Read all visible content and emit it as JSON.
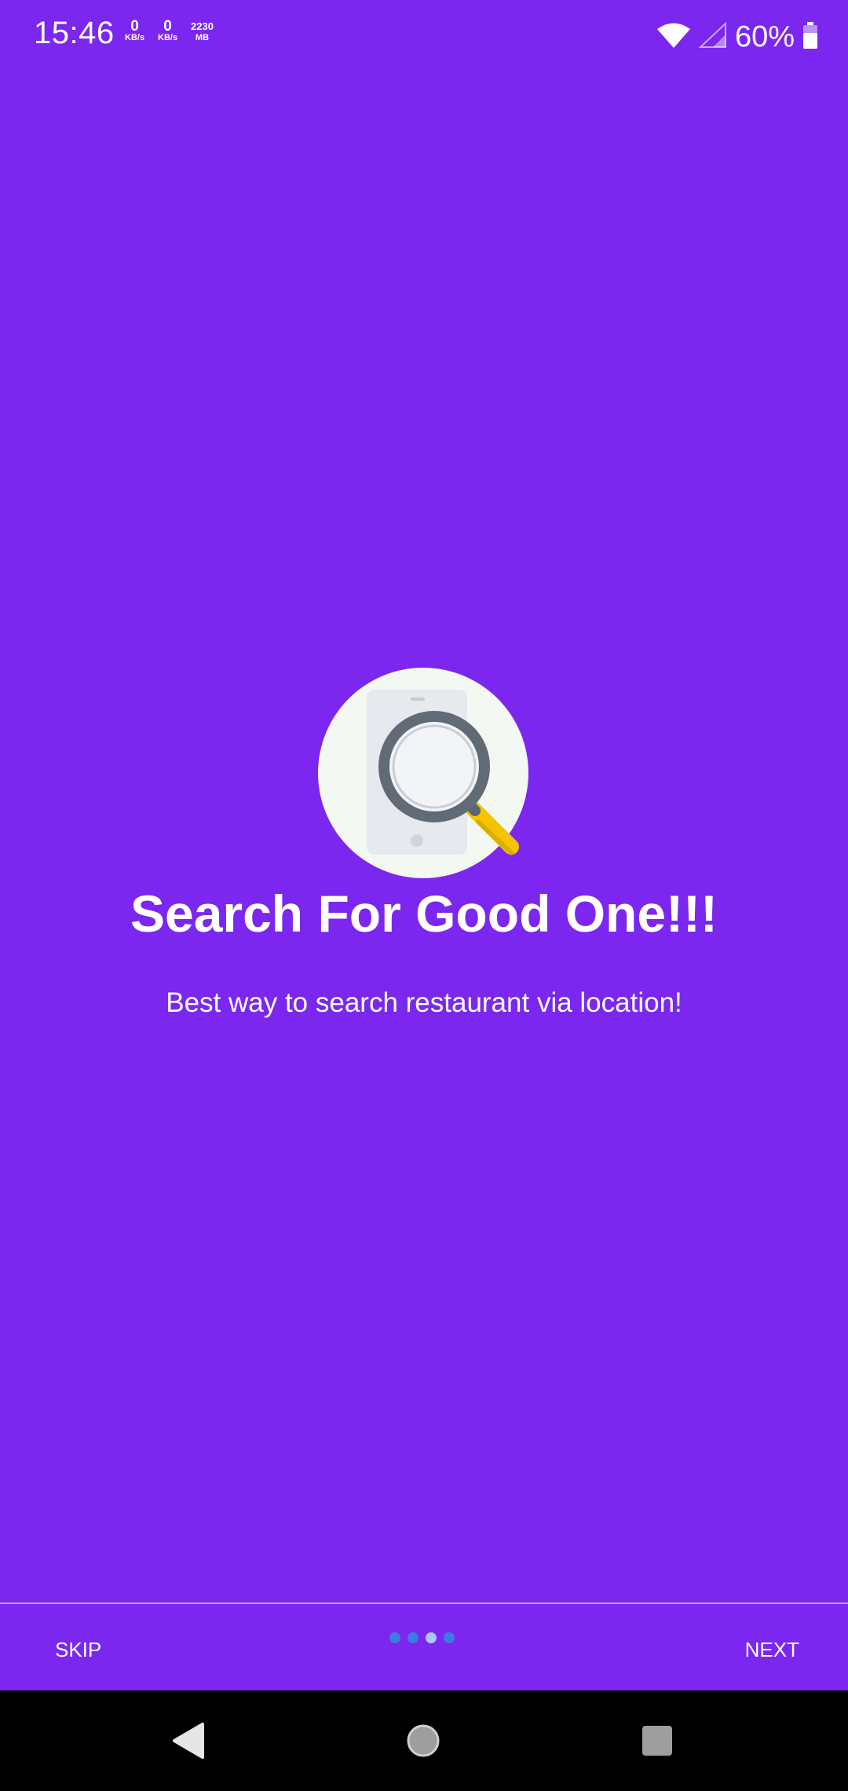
{
  "status_bar": {
    "time": "15:46",
    "net_up": {
      "value": "0",
      "unit": "KB/s"
    },
    "net_down": {
      "value": "0",
      "unit": "KB/s"
    },
    "data_used": {
      "value": "2230",
      "unit": "MB"
    },
    "battery_percent": "60%",
    "icons": [
      "wifi-icon",
      "cell-signal-icon",
      "battery-icon"
    ]
  },
  "onboarding": {
    "illustration_icon": "magnifier-phone-icon",
    "title": "Search For Good One!!!",
    "subtitle": "Best way to search restaurant via location!",
    "page_indicator": {
      "total": 4,
      "current": 3
    }
  },
  "footer": {
    "skip_label": "SKIP",
    "next_label": "NEXT"
  },
  "android_nav": {
    "icons": [
      "back-icon",
      "home-icon",
      "recents-icon"
    ]
  },
  "colors": {
    "background": "#7B27EF",
    "dot_inactive": "#3E7BE0",
    "dot_active": "#A9C6FF"
  }
}
